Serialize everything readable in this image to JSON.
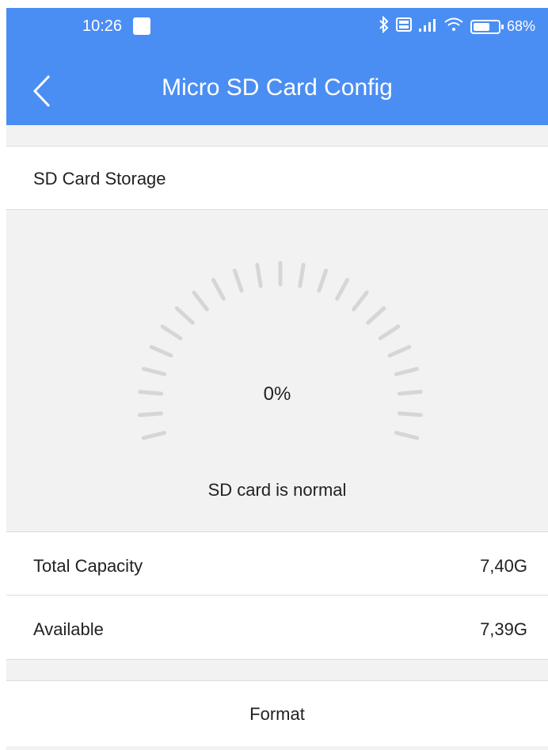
{
  "status_bar": {
    "time": "10:26",
    "battery_percent_label": "68%",
    "battery_level": 0.68,
    "icons": [
      "bluetooth-icon",
      "volte-icon",
      "signal-icon",
      "wifi-icon",
      "battery-icon"
    ]
  },
  "header": {
    "title": "Micro SD Card Config",
    "back_icon": "chevron-left-icon",
    "color": "#4b8ef3"
  },
  "section": {
    "title": "SD Card Storage"
  },
  "gauge": {
    "percent_label": "0%",
    "used_fraction": 0,
    "tick_count": 23,
    "tick_color": "#d6d6d6"
  },
  "status": {
    "text": "SD card is normal"
  },
  "capacity": {
    "total_label": "Total Capacity",
    "total_value": "7,40G",
    "available_label": "Available",
    "available_value": "7,39G"
  },
  "actions": {
    "format_label": "Format"
  }
}
